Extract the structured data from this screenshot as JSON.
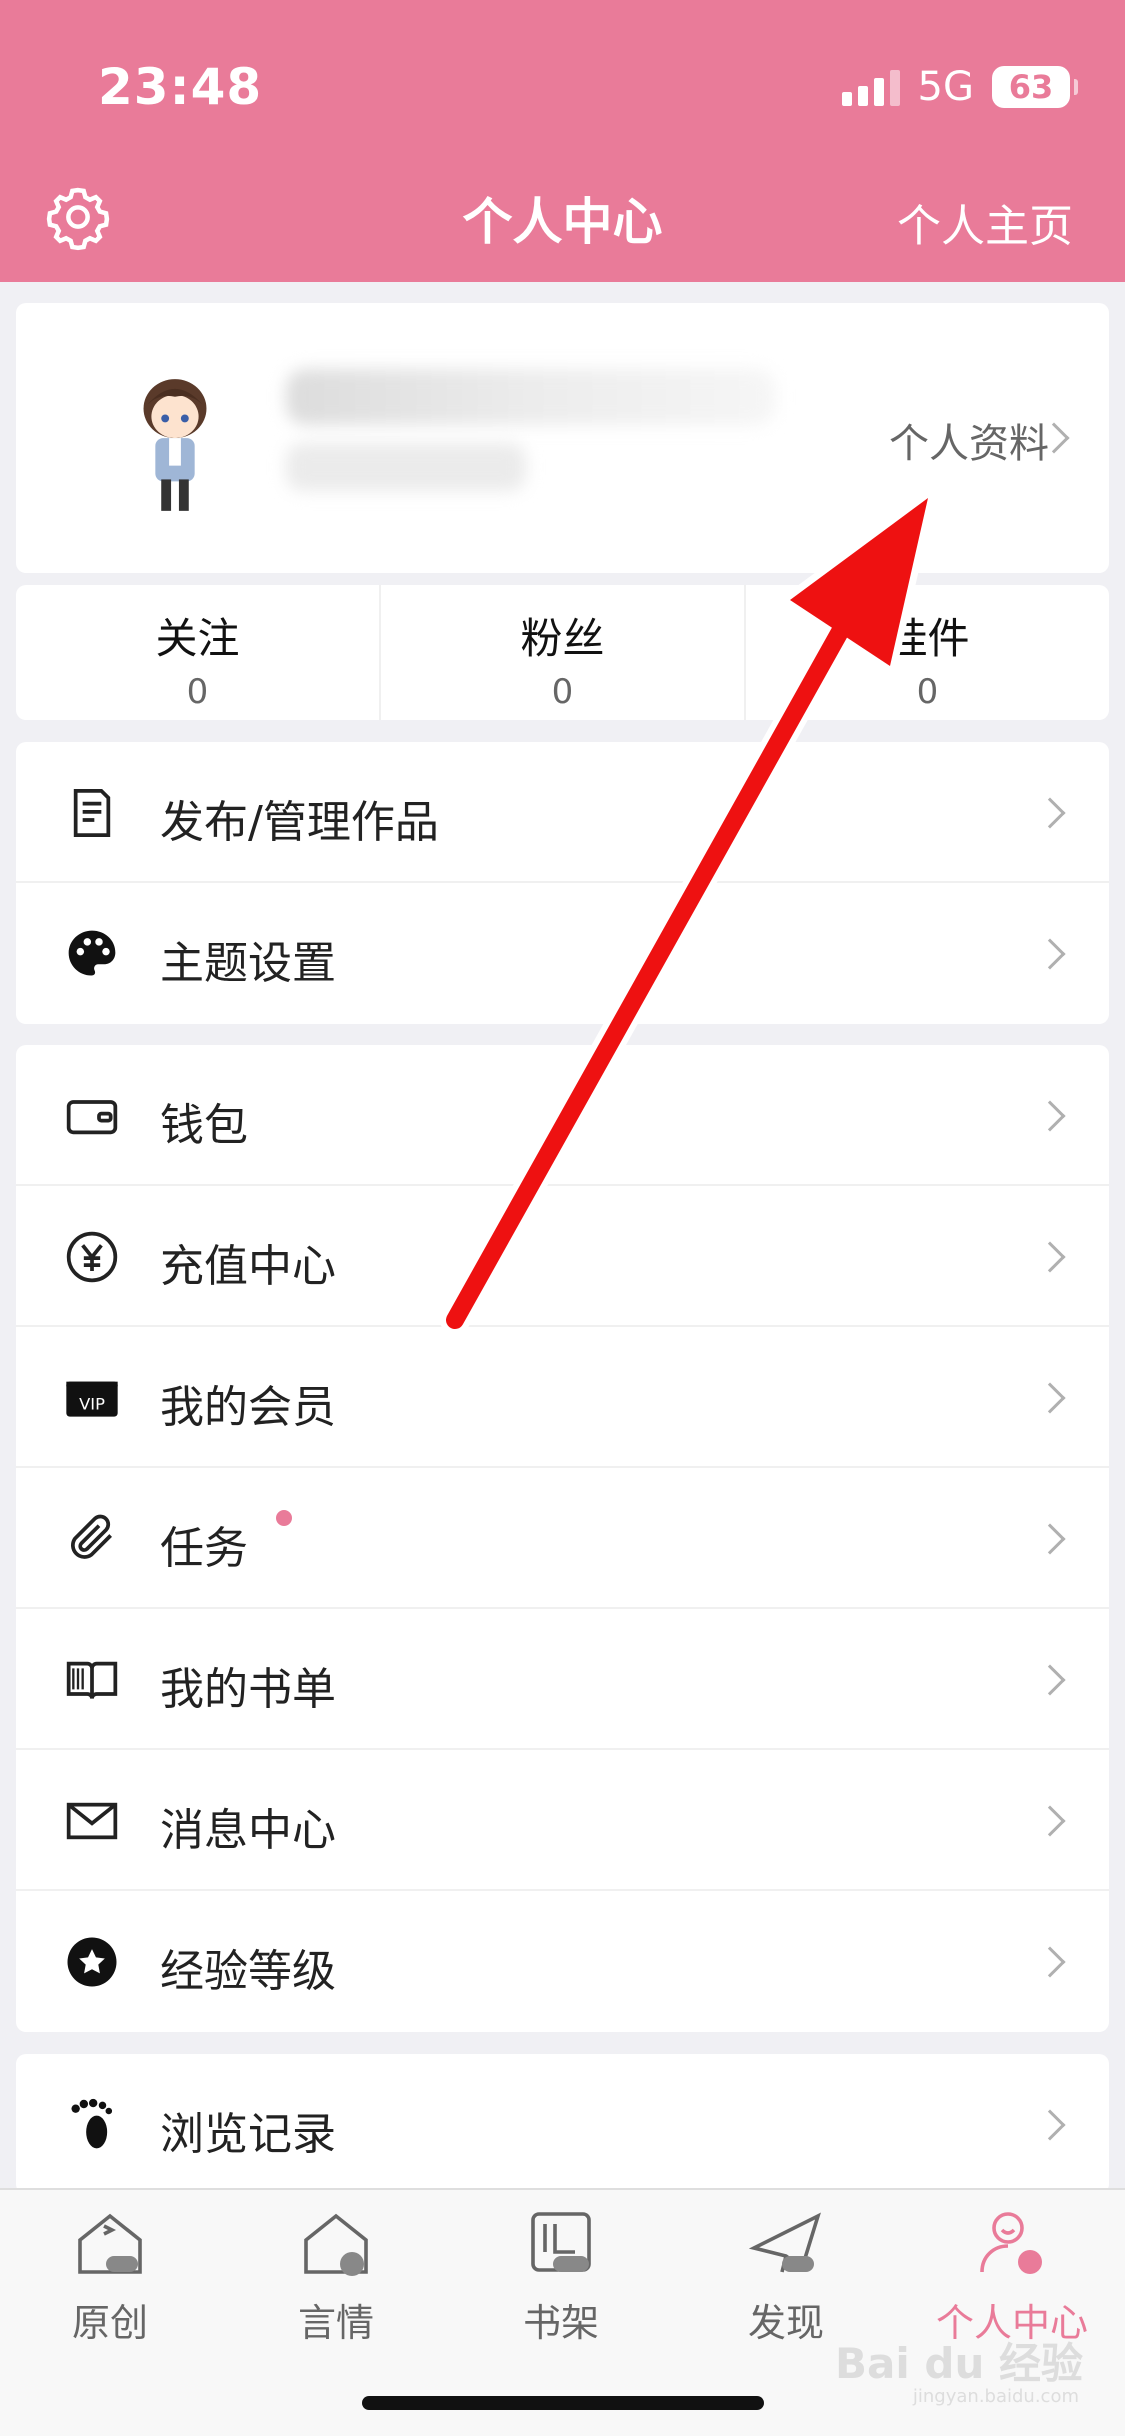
{
  "status": {
    "time": "23:48",
    "network": "5G",
    "battery": "63"
  },
  "header": {
    "title": "个人中心",
    "right_link": "个人主页"
  },
  "profile": {
    "link": "个人资料"
  },
  "stats": [
    {
      "label": "关注",
      "value": "0"
    },
    {
      "label": "粉丝",
      "value": "0"
    },
    {
      "label": "挂件",
      "value": "0"
    }
  ],
  "menu_group1": [
    {
      "label": "发布/管理作品",
      "icon": "document-icon"
    },
    {
      "label": "主题设置",
      "icon": "palette-icon"
    }
  ],
  "menu_group2": [
    {
      "label": "钱包",
      "icon": "wallet-icon"
    },
    {
      "label": "充值中心",
      "icon": "yen-icon"
    },
    {
      "label": "我的会员",
      "icon": "vip-icon"
    },
    {
      "label": "任务",
      "icon": "paperclip-icon"
    },
    {
      "label": "我的书单",
      "icon": "book-icon"
    },
    {
      "label": "消息中心",
      "icon": "mail-icon"
    },
    {
      "label": "经验等级",
      "icon": "star-badge-icon"
    }
  ],
  "menu_group3": [
    {
      "label": "浏览记录",
      "icon": "footprint-icon"
    }
  ],
  "vip_text": "VIP",
  "tabs": [
    {
      "label": "原创",
      "icon": "original-icon"
    },
    {
      "label": "言情",
      "icon": "romance-icon"
    },
    {
      "label": "书架",
      "icon": "bookshelf-icon"
    },
    {
      "label": "发现",
      "icon": "discover-icon"
    },
    {
      "label": "个人中心",
      "icon": "profile-icon",
      "active": true
    }
  ],
  "watermark": {
    "text": "Bai du 经验",
    "sub": "jingyan.baidu.com"
  },
  "colors": {
    "accent": "#e97b99",
    "arrow": "#ee1111"
  }
}
